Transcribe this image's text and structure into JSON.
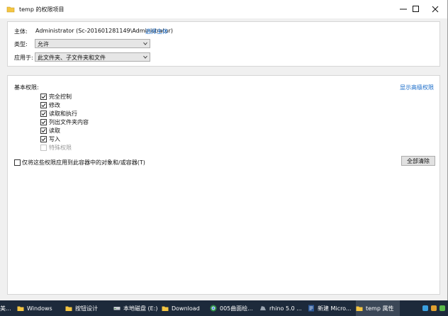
{
  "window": {
    "title": "temp 的权限项目",
    "controls": {
      "minimize": "minimize",
      "maximize": "maximize",
      "close": "close"
    }
  },
  "principal": {
    "label": "主体:",
    "value": "Administrator (Sc-201601281149\\Administrator)",
    "select_link": "选择主体"
  },
  "type": {
    "label": "类型:",
    "value": "允许"
  },
  "applies_to": {
    "label": "应用于:",
    "value": "此文件夹、子文件夹和文件"
  },
  "permissions": {
    "heading": "基本权限:",
    "advanced_link": "显示高级权限",
    "items": [
      {
        "label": "完全控制",
        "checked": true,
        "enabled": true
      },
      {
        "label": "修改",
        "checked": true,
        "enabled": true
      },
      {
        "label": "读取和执行",
        "checked": true,
        "enabled": true
      },
      {
        "label": "列出文件夹内容",
        "checked": true,
        "enabled": true
      },
      {
        "label": "读取",
        "checked": true,
        "enabled": true
      },
      {
        "label": "写入",
        "checked": true,
        "enabled": true
      },
      {
        "label": "特殊权限",
        "checked": false,
        "enabled": false
      }
    ],
    "apply_only_label": "仅将这些权限应用到此容器中的对象和/或容器(T)",
    "clear_all_label": "全部清除"
  },
  "taskbar": {
    "items": [
      {
        "label": "美..."
      },
      {
        "label": "Windows"
      },
      {
        "label": "按钮设计"
      },
      {
        "label": "本地磁盘 (E:)"
      },
      {
        "label": "Download"
      },
      {
        "label": "005曲面绘..."
      },
      {
        "label": "rhino 5.0 ..."
      },
      {
        "label": "新建 Micro..."
      },
      {
        "label": "temp 属性"
      }
    ]
  },
  "colors": {
    "link": "#1a6cc9",
    "taskbar_bg": "#1d2a3b",
    "folder": "#f4c542"
  }
}
